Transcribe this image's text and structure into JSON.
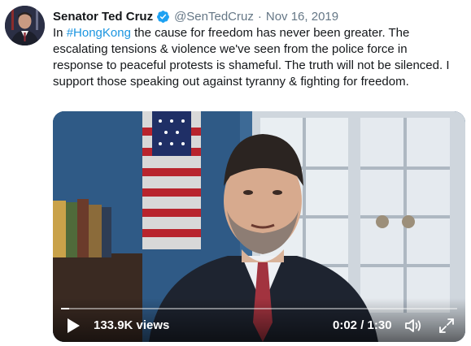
{
  "tweet": {
    "author": {
      "display_name": "Senator Ted Cruz",
      "handle": "@SenTedCruz",
      "verified": true
    },
    "separator": "·",
    "date": "Nov 16, 2019",
    "text": {
      "before_hashtag": "In ",
      "hashtag": "#HongKong",
      "after_hashtag": " the cause for freedom has never been greater. The escalating tensions & violence we've seen from the police force in response to peaceful protests is shameful. The truth will not be silenced. I support those speaking out against tyranny & fighting for freedom."
    }
  },
  "video": {
    "views": "133.9K views",
    "time": "0:02 / 1:30",
    "progress_fraction": 0.02,
    "icons": {
      "play": "play-icon",
      "volume": "volume-icon",
      "fullscreen": "fullscreen-icon"
    }
  },
  "colors": {
    "link": "#1b95e0",
    "verified_badge": "#1da1f2",
    "secondary_text": "#657786",
    "primary_text": "#14171a"
  }
}
